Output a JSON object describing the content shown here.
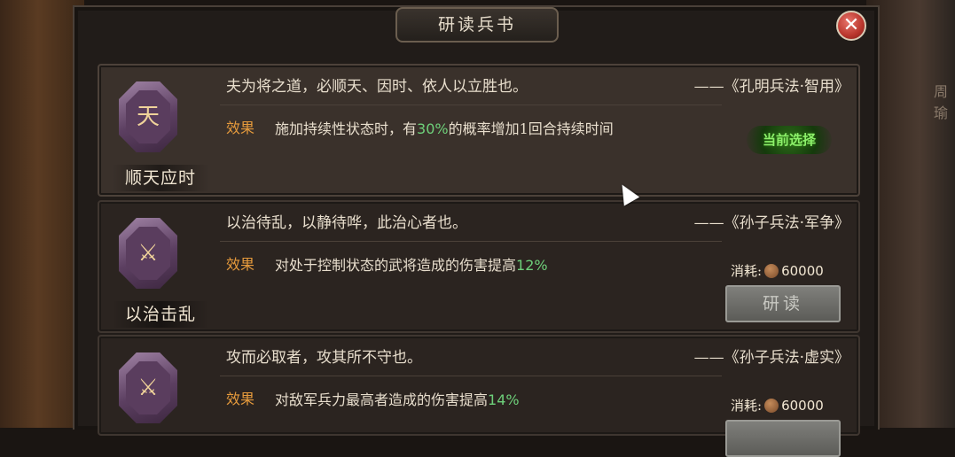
{
  "window": {
    "title": "研读兵书",
    "close_glyph": "✕"
  },
  "background": {
    "side_text": "周瑜"
  },
  "cards": [
    {
      "name": "顺天应时",
      "icon_glyph": "天",
      "icon": "banner-icon",
      "quote": "夫为将之道，必顺天、因时、依人以立胜也。",
      "source": "——《孔明兵法·智用》",
      "effect_label": "效果",
      "effect_pre": "施加持续性状态时，有",
      "effect_num": "30%",
      "effect_post": "的概率增加1回合持续时间",
      "status": "当前选择"
    },
    {
      "name": "以治击乱",
      "icon_glyph": "⚔",
      "icon": "warrior-axe-icon",
      "quote": "以治待乱，以静待哗，此治心者也。",
      "source": "——《孙子兵法·军争》",
      "effect_label": "效果",
      "effect_pre": "对处于控制状态的武将造成的伤害提高",
      "effect_num": "12%",
      "effect_post": "",
      "cost_label": "消耗:",
      "cost_value": "60000",
      "button_label": "研读"
    },
    {
      "name": "",
      "icon_glyph": "⚔",
      "icon": "warrior-sword-icon",
      "quote": "攻而必取者，攻其所不守也。",
      "source": "——《孙子兵法·虚实》",
      "effect_label": "效果",
      "effect_pre": "对敌军兵力最高者造成的伤害提高",
      "effect_num": "14%",
      "effect_post": "",
      "cost_label": "消耗:",
      "cost_value": "60000",
      "button_label": ""
    }
  ],
  "colors": {
    "effect_label": "#e59a3c",
    "percent_highlight": "#6ed07a",
    "selected_badge": "#8cf06a"
  }
}
